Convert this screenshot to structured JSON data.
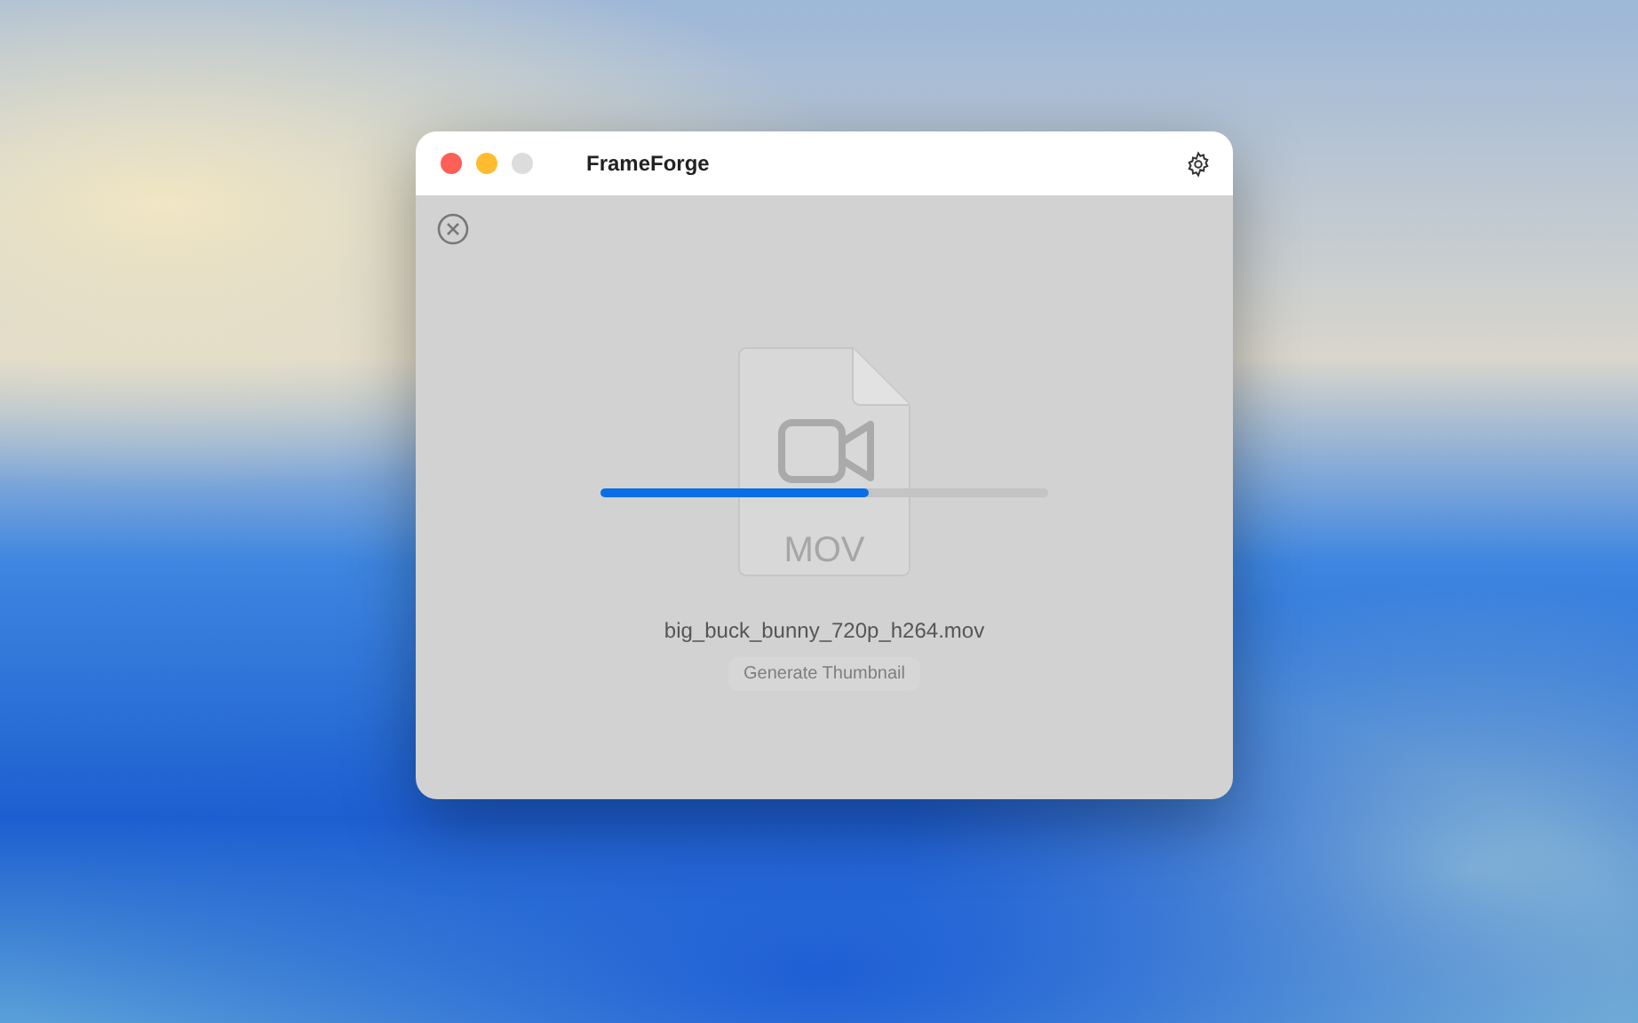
{
  "window": {
    "title": "FrameForge"
  },
  "file": {
    "type_label": "MOV",
    "name": "big_buck_bunny_720p_h264.mov"
  },
  "progress": {
    "level": 0.6
  },
  "button": {
    "label": "Generate Thumbnail",
    "disabled": true
  }
}
